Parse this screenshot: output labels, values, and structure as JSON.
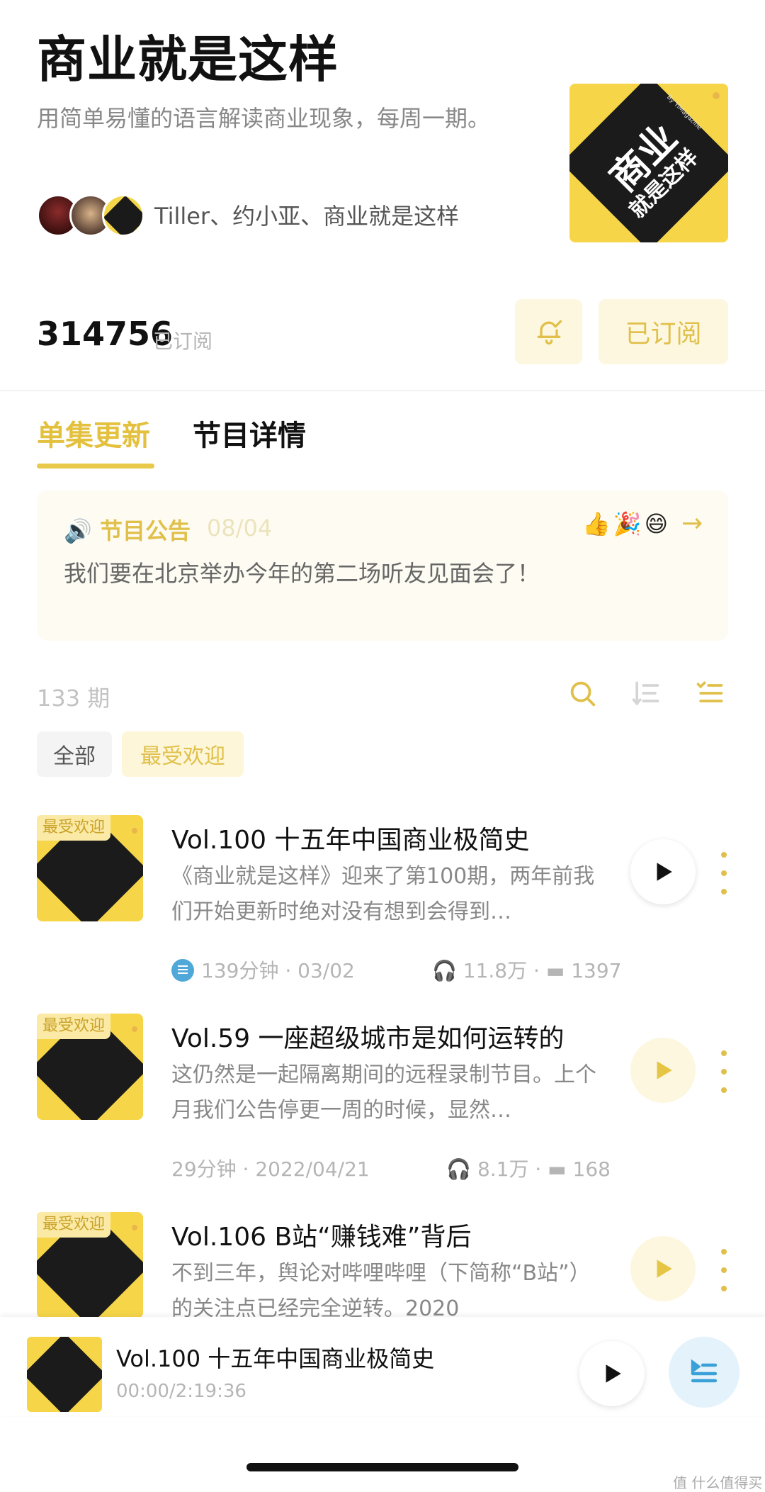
{
  "header": {
    "title": "商业就是这样",
    "description": "用简单易懂的语言解读商业现象，每周一期。",
    "hosts": "Tiller、约小亚、商业就是这样",
    "cover_text_1": "商业",
    "cover_text_2": "就是这样",
    "cover_by": "By YiMagazine"
  },
  "subscription": {
    "count": "314756",
    "count_label": "已订阅",
    "subscribed_label": "已订阅"
  },
  "tabs": [
    {
      "label": "单集更新",
      "active": true
    },
    {
      "label": "节目详情",
      "active": false
    }
  ],
  "notice": {
    "title": "节目公告",
    "date": "08/04",
    "emojis": "👍🎉😄",
    "body": "我们要在北京举办今年的第二场听友见面会了！"
  },
  "list": {
    "count": "133 期",
    "filters": [
      "全部",
      "最受欢迎"
    ]
  },
  "episodes": [
    {
      "badge": "最受欢迎",
      "title": "Vol.100 十五年中国商业极简史",
      "description": "《商业就是这样》迎来了第100期，两年前我们开始更新时绝对没有想到会得到…",
      "duration": "139分钟",
      "date": "03/02",
      "plays": "11.8万",
      "comments": "1397"
    },
    {
      "badge": "最受欢迎",
      "title": "Vol.59 一座超级城市是如何运转的",
      "description": "这仍然是一起隔离期间的远程录制节目。上个月我们公告停更一周的时候，显然…",
      "duration": "29分钟",
      "date": "2022/04/21",
      "plays": "8.1万",
      "comments": "168"
    },
    {
      "badge": "最受欢迎",
      "title": "Vol.106 B站“赚钱难”背后",
      "description": "不到三年，舆论对哔哩哔哩（下简称“B站”）的关注点已经完全逆转。2020",
      "duration": "",
      "date": "",
      "plays": "",
      "comments": ""
    }
  ],
  "player": {
    "title": "Vol.100 十五年中国商业极简史",
    "time": "00:00/2:19:36"
  },
  "watermark": "值 什么值得买",
  "colors": {
    "accent": "#e6c544",
    "cover_yellow": "#f6d648",
    "blue": "#4fa8d8"
  }
}
